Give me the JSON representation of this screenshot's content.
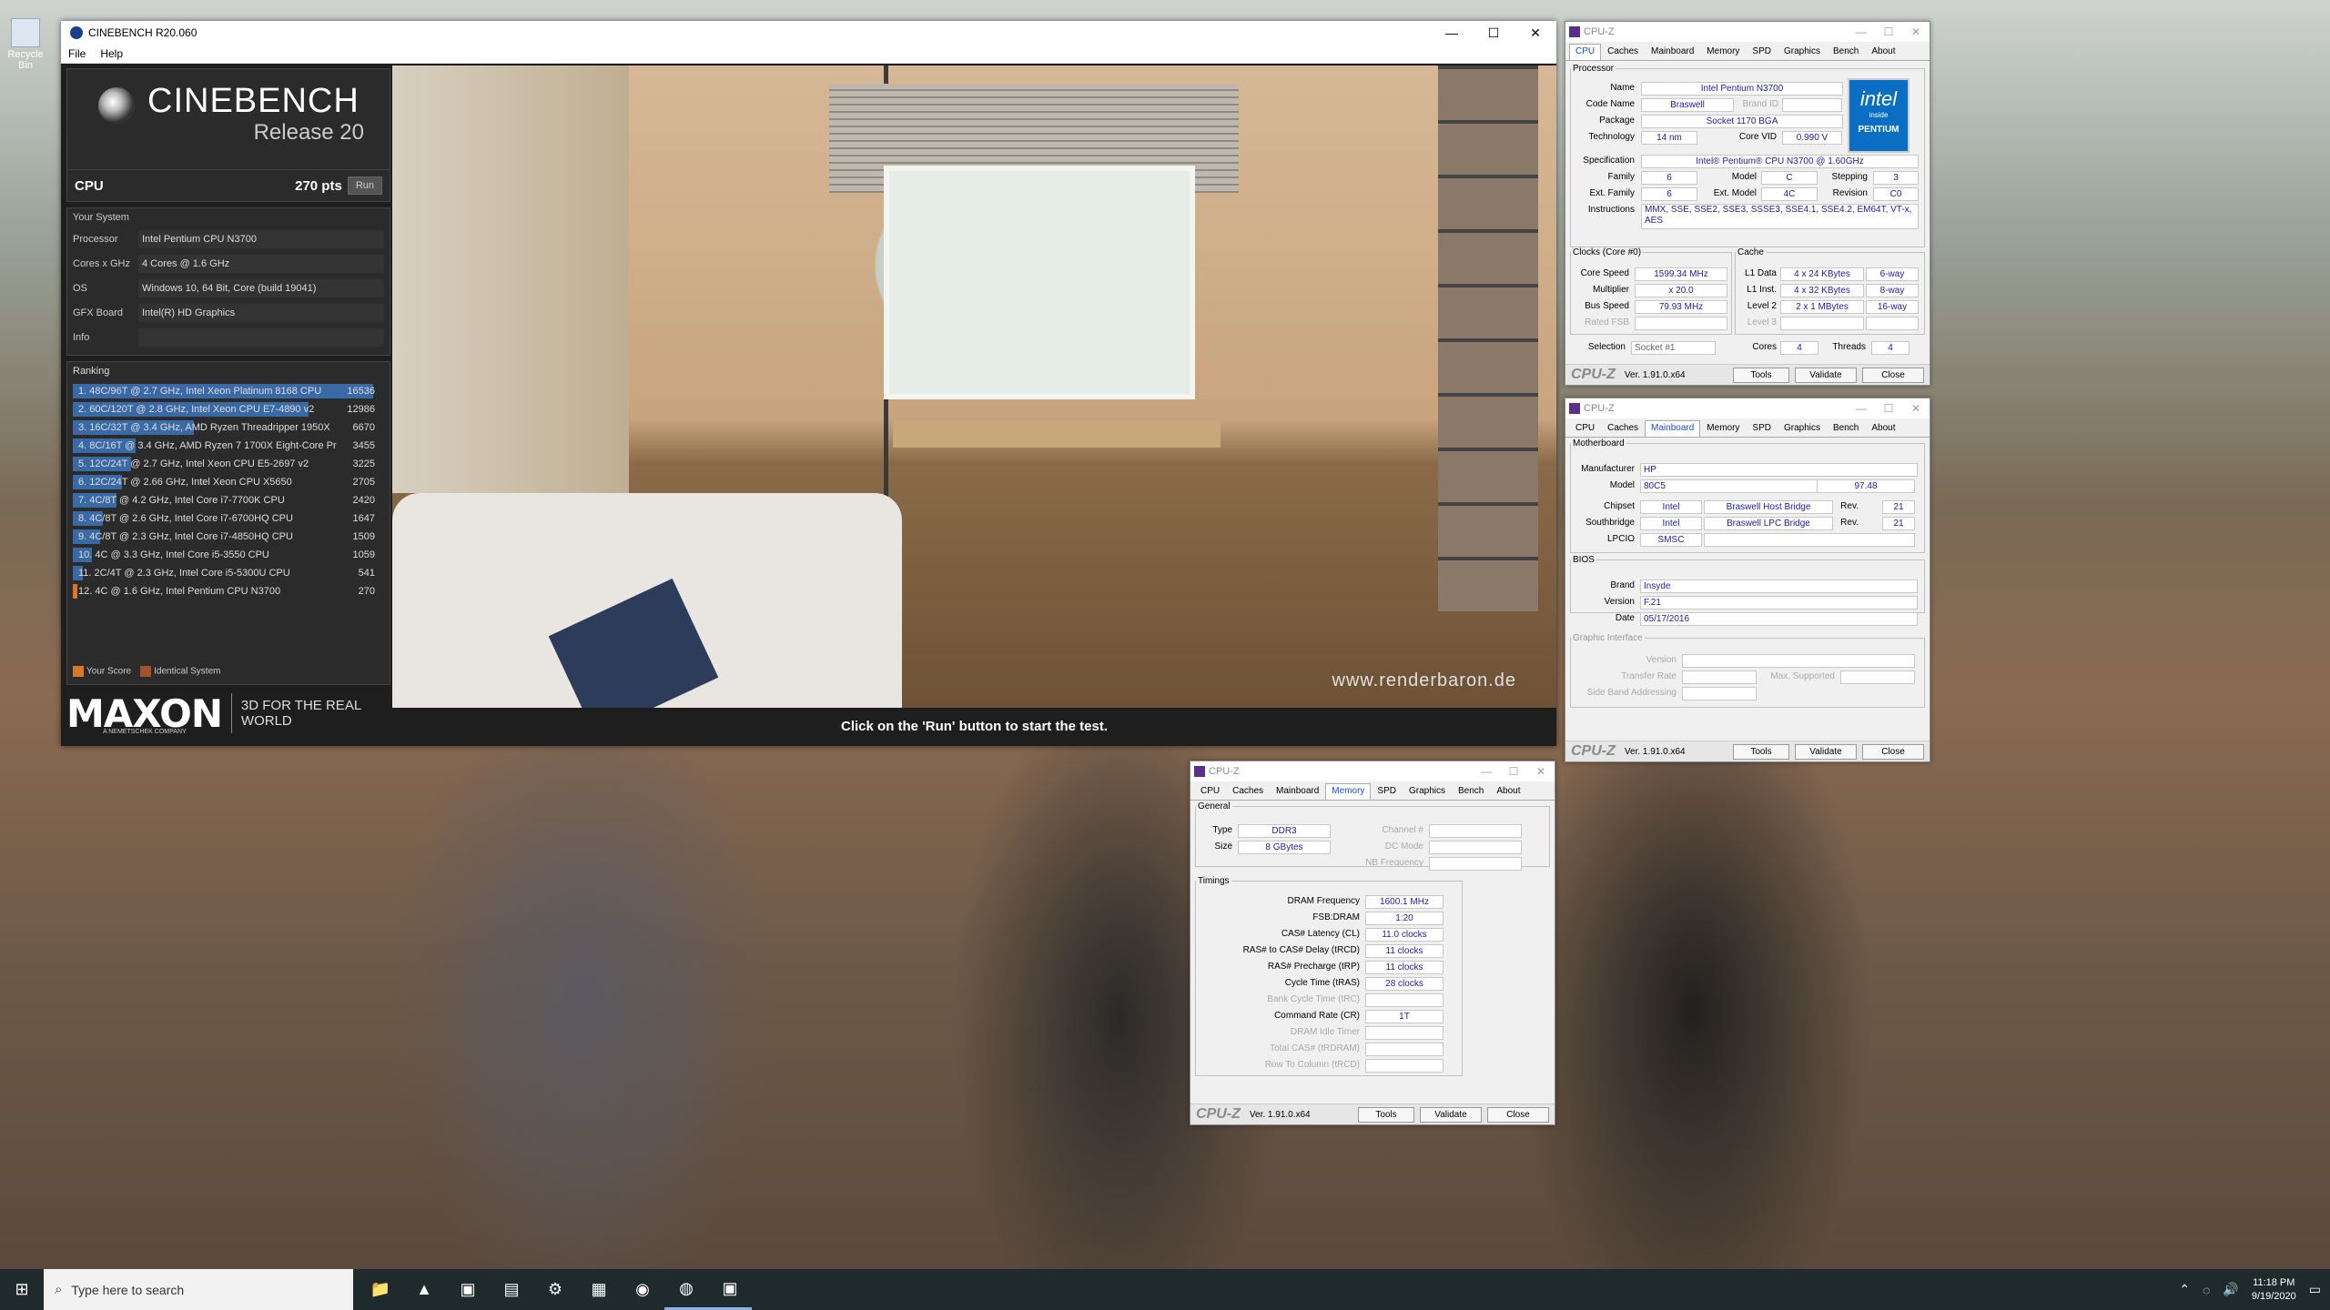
{
  "desktop": {
    "recycle_bin": "Recycle Bin"
  },
  "cinebench": {
    "title": "CINEBENCH R20.060",
    "menu": [
      "File",
      "Help"
    ],
    "brand": "CINEBENCH",
    "release": "Release 20",
    "cpu_label": "CPU",
    "cpu_score": "270 pts",
    "run_label": "Run",
    "your_system": "Your System",
    "system": [
      {
        "k": "Processor",
        "v": "Intel Pentium CPU N3700"
      },
      {
        "k": "Cores x GHz",
        "v": "4 Cores @ 1.6 GHz"
      },
      {
        "k": "OS",
        "v": "Windows 10, 64 Bit, Core (build 19041)"
      },
      {
        "k": "GFX Board",
        "v": "Intel(R) HD Graphics"
      },
      {
        "k": "Info",
        "v": ""
      }
    ],
    "ranking_label": "Ranking",
    "ranking": [
      {
        "text": "1. 48C/96T @ 2.7 GHz, Intel Xeon Platinum 8168 CPU",
        "score": 16536,
        "mine": false
      },
      {
        "text": "2. 60C/120T @ 2.8 GHz, Intel Xeon CPU E7-4890 v2",
        "score": 12986,
        "mine": false
      },
      {
        "text": "3. 16C/32T @ 3.4 GHz, AMD Ryzen Threadripper 1950X",
        "score": 6670,
        "mine": false
      },
      {
        "text": "4. 8C/16T @ 3.4 GHz, AMD Ryzen 7 1700X Eight-Core Pr",
        "score": 3455,
        "mine": false
      },
      {
        "text": "5. 12C/24T @ 2.7 GHz, Intel Xeon CPU E5-2697 v2",
        "score": 3225,
        "mine": false
      },
      {
        "text": "6. 12C/24T @ 2.66 GHz, Intel Xeon CPU X5650",
        "score": 2705,
        "mine": false
      },
      {
        "text": "7. 4C/8T @ 4.2 GHz, Intel Core i7-7700K CPU",
        "score": 2420,
        "mine": false
      },
      {
        "text": "8. 4C/8T @ 2.6 GHz, Intel Core i7-6700HQ CPU",
        "score": 1647,
        "mine": false
      },
      {
        "text": "9. 4C/8T @ 2.3 GHz, Intel Core i7-4850HQ CPU",
        "score": 1509,
        "mine": false
      },
      {
        "text": "10. 4C @ 3.3 GHz, Intel Core i5-3550 CPU",
        "score": 1059,
        "mine": false
      },
      {
        "text": "11. 2C/4T @ 2.3 GHz, Intel Core i5-5300U CPU",
        "score": 541,
        "mine": false
      },
      {
        "text": "12. 4C @ 1.6 GHz, Intel Pentium CPU N3700",
        "score": 270,
        "mine": true
      }
    ],
    "legend_your": "Your Score",
    "legend_identical": "Identical System",
    "your_color": "#d8762a",
    "identical_color": "#a0522d",
    "maxon": "MAXON",
    "maxon_sub": "A NEMETSCHEK COMPANY",
    "tagline": "3D FOR THE REAL WORLD",
    "watermark": "www.renderbaron.de",
    "status": "Click on the 'Run' button to start the test."
  },
  "cpuz_tabs": [
    "CPU",
    "Caches",
    "Mainboard",
    "Memory",
    "SPD",
    "Graphics",
    "Bench",
    "About"
  ],
  "cpuz_common": {
    "title": "CPU-Z",
    "brand": "CPU-Z",
    "version": "Ver. 1.91.0.x64",
    "tools": "Tools",
    "validate": "Validate",
    "close": "Close"
  },
  "cpuz_cpu": {
    "processor_legend": "Processor",
    "name_l": "Name",
    "name": "Intel Pentium N3700",
    "codename_l": "Code Name",
    "codename": "Braswell",
    "brandid_l": "Brand ID",
    "package_l": "Package",
    "package": "Socket 1170 BGA",
    "tech_l": "Technology",
    "tech": "14 nm",
    "vid_l": "Core VID",
    "vid": "0.990 V",
    "spec_l": "Specification",
    "spec": "Intel® Pentium® CPU  N3700  @ 1.60GHz",
    "family_l": "Family",
    "family": "6",
    "model_l": "Model",
    "model": "C",
    "stepping_l": "Stepping",
    "stepping": "3",
    "extfam_l": "Ext. Family",
    "extfam": "6",
    "extmod_l": "Ext. Model",
    "extmod": "4C",
    "rev_l": "Revision",
    "rev": "C0",
    "instr_l": "Instructions",
    "instr": "MMX, SSE, SSE2, SSE3, SSSE3, SSE4.1, SSE4.2, EM64T, VT-x, AES",
    "clocks_legend": "Clocks (Core #0)",
    "cspeed_l": "Core Speed",
    "cspeed": "1599.34 MHz",
    "mult_l": "Multiplier",
    "mult": "x 20.0",
    "bus_l": "Bus Speed",
    "bus": "79.93 MHz",
    "fsb_l": "Rated FSB",
    "cache_legend": "Cache",
    "l1d_l": "L1 Data",
    "l1d": "4 x 24 KBytes",
    "l1d_w": "6-way",
    "l1i_l": "L1 Inst.",
    "l1i": "4 x 32 KBytes",
    "l1i_w": "8-way",
    "l2_l": "Level 2",
    "l2": "2 x 1 MBytes",
    "l2_w": "16-way",
    "l3_l": "Level 3",
    "selection_l": "Selection",
    "selection": "Socket #1",
    "cores_l": "Cores",
    "cores": "4",
    "threads_l": "Threads",
    "threads": "4",
    "intel_logo": "intel",
    "intel_inside": "inside",
    "intel_brand": "PENTIUM"
  },
  "cpuz_mb": {
    "mb_legend": "Motherboard",
    "manu_l": "Manufacturer",
    "manu": "HP",
    "model_l": "Model",
    "model": "80C5",
    "model_rev": "97.48",
    "chipset_l": "Chipset",
    "chipset": "Intel",
    "chipset_name": "Braswell Host Bridge",
    "chipset_rev_l": "Rev.",
    "chipset_rev": "21",
    "south_l": "Southbridge",
    "south": "Intel",
    "south_name": "Braswell LPC Bridge",
    "south_rev_l": "Rev.",
    "south_rev": "21",
    "lpcio_l": "LPCIO",
    "lpcio": "SMSC",
    "bios_legend": "BIOS",
    "brand_l": "Brand",
    "brand": "Insyde",
    "version_l": "Version",
    "version": "F.21",
    "date_l": "Date",
    "date": "05/17/2016",
    "gi_legend": "Graphic Interface",
    "gi_version_l": "Version",
    "gi_rate_l": "Transfer Rate",
    "gi_max_l": "Max. Supported",
    "gi_sba_l": "Side Band Addressing"
  },
  "cpuz_mem": {
    "general_legend": "General",
    "type_l": "Type",
    "type": "DDR3",
    "size_l": "Size",
    "size": "8 GBytes",
    "chan_l": "Channel #",
    "dc_l": "DC Mode",
    "nb_l": "NB Frequency",
    "timings_legend": "Timings",
    "rows": [
      {
        "l": "DRAM Frequency",
        "v": "1600.1 MHz",
        "gray": false
      },
      {
        "l": "FSB:DRAM",
        "v": "1:20",
        "gray": false
      },
      {
        "l": "CAS# Latency (CL)",
        "v": "11.0 clocks",
        "gray": false
      },
      {
        "l": "RAS# to CAS# Delay (tRCD)",
        "v": "11 clocks",
        "gray": false
      },
      {
        "l": "RAS# Precharge (tRP)",
        "v": "11 clocks",
        "gray": false
      },
      {
        "l": "Cycle Time (tRAS)",
        "v": "28 clocks",
        "gray": false
      },
      {
        "l": "Bank Cycle Time (tRC)",
        "v": "",
        "gray": true
      },
      {
        "l": "Command Rate (CR)",
        "v": "1T",
        "gray": false
      },
      {
        "l": "DRAM Idle Timer",
        "v": "",
        "gray": true
      },
      {
        "l": "Total CAS# (tRDRAM)",
        "v": "",
        "gray": true
      },
      {
        "l": "Row To Column (tRCD)",
        "v": "",
        "gray": true
      }
    ]
  },
  "taskbar": {
    "search_placeholder": "Type here to search",
    "time": "11:18 PM",
    "date": "9/19/2020"
  }
}
